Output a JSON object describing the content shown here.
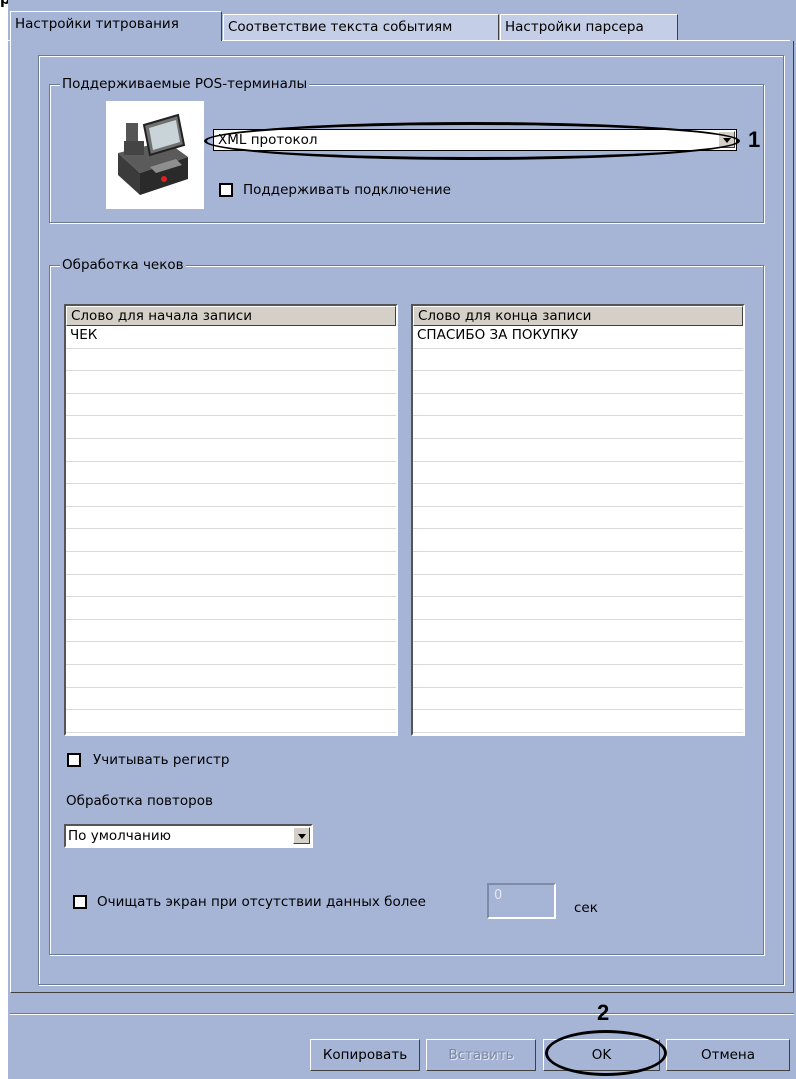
{
  "page_fragment": "ра",
  "tabs": [
    {
      "label": "Настройки титрования"
    },
    {
      "label": "Соответствие текста событиям"
    },
    {
      "label": "Настройки парсера"
    }
  ],
  "pos_group": {
    "title": "Поддерживаемые POS-терминалы",
    "protocol_value": "XML протокол",
    "support_connection_label": "Поддерживать подключение"
  },
  "receipt_group": {
    "title": "Обработка чеков",
    "start_header": "Слово для начала записи",
    "end_header": "Слово для конца записи",
    "start_rows": [
      "ЧЕК",
      "",
      "",
      "",
      "",
      "",
      "",
      "",
      "",
      "",
      "",
      "",
      "",
      "",
      "",
      "",
      "",
      ""
    ],
    "end_rows": [
      "СПАСИБО ЗА ПОКУПКУ",
      "",
      "",
      "",
      "",
      "",
      "",
      "",
      "",
      "",
      "",
      "",
      "",
      "",
      "",
      "",
      "",
      ""
    ],
    "case_label": "Учитывать регистр",
    "repeat_label": "Обработка повторов",
    "repeat_value": "По умолчанию",
    "clear_label": "Очищать экран при отсутствии данных более",
    "clear_value": "0",
    "clear_unit": "сек"
  },
  "buttons": {
    "copy": "Копировать",
    "paste": "Вставить",
    "ok": "OK",
    "cancel": "Отмена"
  },
  "annotations": {
    "one": "1",
    "two": "2"
  }
}
